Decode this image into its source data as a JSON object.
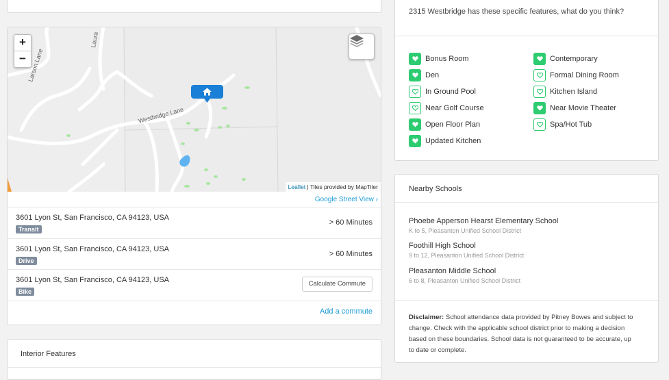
{
  "map": {
    "zoom_in": "+",
    "zoom_out": "−",
    "layers_icon": "layers-icon",
    "home_marker_icon": "home-icon",
    "street_labels": [
      "Larson Lane",
      "Laura",
      "Westbridge Lane"
    ],
    "attribution_link": "Leaflet",
    "attribution_text": " | Tiles provided by MapTiler",
    "street_view_label": "Google Street View ›"
  },
  "commutes": [
    {
      "address": "3601 Lyon St, San Francisco, CA 94123, USA",
      "mode": "Transit",
      "time": "> 60 Minutes"
    },
    {
      "address": "3601 Lyon St, San Francisco, CA 94123, USA",
      "mode": "Drive",
      "time": "> 60 Minutes"
    },
    {
      "address": "3601 Lyon St, San Francisco, CA 94123, USA",
      "mode": "Bike",
      "button": "Calculate Commute"
    }
  ],
  "add_commute_label": "Add a commute",
  "interior": {
    "title": "Interior Features"
  },
  "features": {
    "question": "2315 Westbridge has these specific features, what do you think?",
    "items": [
      {
        "label": "Bonus Room",
        "liked": true
      },
      {
        "label": "Contemporary",
        "liked": true
      },
      {
        "label": "Den",
        "liked": true
      },
      {
        "label": "Formal Dining Room",
        "liked": false
      },
      {
        "label": "In Ground Pool",
        "liked": false
      },
      {
        "label": "Kitchen Island",
        "liked": false
      },
      {
        "label": "Near Golf Course",
        "liked": false
      },
      {
        "label": "Near Movie Theater",
        "liked": true
      },
      {
        "label": "Open Floor Plan",
        "liked": true
      },
      {
        "label": "Spa/Hot Tub",
        "liked": false
      },
      {
        "label": "Updated Kitchen",
        "liked": true
      }
    ]
  },
  "schools": {
    "title": "Nearby Schools",
    "items": [
      {
        "name": "Phoebe Apperson Hearst Elementary School",
        "sub": "K to 5, Pleasanton Unified School District"
      },
      {
        "name": "Foothill High School",
        "sub": "9 to 12, Pleasanton Unified School District"
      },
      {
        "name": "Pleasanton Middle School",
        "sub": "6 to 8, Pleasanton Unified School District"
      }
    ],
    "disclaimer_label": "Disclaimer:",
    "disclaimer_text": " School attendance data provided by Pitney Bowes and subject to change. Check with the applicable school district prior to making a decision based on these boundaries. School data is not guaranteed to be accurate, up to date or complete."
  },
  "colors": {
    "accent": "#2ecc71",
    "link": "#1a9bd7",
    "marker": "#1a7fd6",
    "tag": "#7f8c9d"
  }
}
